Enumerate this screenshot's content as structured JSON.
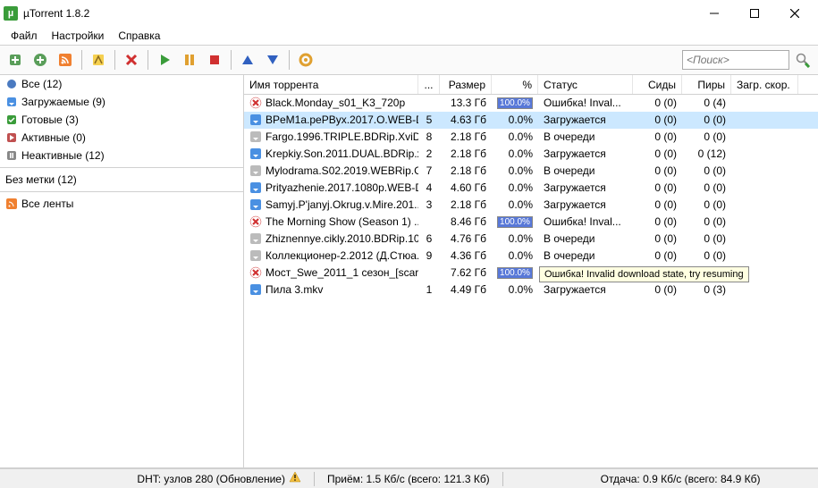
{
  "window": {
    "title": "µTorrent 1.8.2"
  },
  "menu": {
    "file": "Файл",
    "settings": "Настройки",
    "help": "Справка"
  },
  "search": {
    "placeholder": "<Поиск>"
  },
  "sidebar": {
    "all": "Все (12)",
    "downloading": "Загружаемые (9)",
    "completed": "Готовые (3)",
    "active": "Активные (0)",
    "inactive": "Неактивные (12)",
    "nolabel": "Без метки (12)",
    "feeds": "Все ленты"
  },
  "columns": {
    "name": "Имя торрента",
    "num": "...",
    "size": "Размер",
    "pct": "%",
    "status": "Статус",
    "seeds": "Сиды",
    "peers": "Пиры",
    "speed": "Загр. скор."
  },
  "torrents": [
    {
      "icon": "error",
      "name": "Black.Monday_s01_K3_720p",
      "num": "",
      "size": "13.3 Гб",
      "pct": "100.0%",
      "pctFull": true,
      "status": "Ошибка! Inval...",
      "seeds": "0 (0)",
      "peers": "0 (4)"
    },
    {
      "icon": "down",
      "name": "BPeM1a.pePByx.2017.O.WEB-D...",
      "num": "5",
      "size": "4.63 Гб",
      "pct": "0.0%",
      "pctFull": false,
      "status": "Загружается",
      "seeds": "0 (0)",
      "peers": "0 (0)",
      "selected": true
    },
    {
      "icon": "queued",
      "name": "Fargo.1996.TRIPLE.BDRip.XviD...",
      "num": "8",
      "size": "2.18 Гб",
      "pct": "0.0%",
      "pctFull": false,
      "status": "В очереди",
      "seeds": "0 (0)",
      "peers": "0 (0)"
    },
    {
      "icon": "down",
      "name": "Krepkiy.Son.2011.DUAL.BDRip.x...",
      "num": "2",
      "size": "2.18 Гб",
      "pct": "0.0%",
      "pctFull": false,
      "status": "Загружается",
      "seeds": "0 (0)",
      "peers": "0 (12)"
    },
    {
      "icon": "queued",
      "name": "Mylodrama.S02.2019.WEBRip.G...",
      "num": "7",
      "size": "2.18 Гб",
      "pct": "0.0%",
      "pctFull": false,
      "status": "В очереди",
      "seeds": "0 (0)",
      "peers": "0 (0)"
    },
    {
      "icon": "down",
      "name": "Prityazhenie.2017.1080p.WEB-D...",
      "num": "4",
      "size": "4.60 Гб",
      "pct": "0.0%",
      "pctFull": false,
      "status": "Загружается",
      "seeds": "0 (0)",
      "peers": "0 (0)"
    },
    {
      "icon": "down",
      "name": "Samyj.P'janyj.Okrug.v.Mire.201...",
      "num": "3",
      "size": "2.18 Гб",
      "pct": "0.0%",
      "pctFull": false,
      "status": "Загружается",
      "seeds": "0 (0)",
      "peers": "0 (0)"
    },
    {
      "icon": "error",
      "name": "The Morning Show (Season 1) ...",
      "num": "",
      "size": "8.46 Гб",
      "pct": "100.0%",
      "pctFull": true,
      "status": "Ошибка! Inval...",
      "seeds": "0 (0)",
      "peers": "0 (0)"
    },
    {
      "icon": "queued",
      "name": "Zhiznennye.cikly.2010.BDRip.10...",
      "num": "6",
      "size": "4.76 Гб",
      "pct": "0.0%",
      "pctFull": false,
      "status": "В очереди",
      "seeds": "0 (0)",
      "peers": "0 (0)"
    },
    {
      "icon": "queued",
      "name": "Коллекционер-2.2012 (Д.Стюа...",
      "num": "9",
      "size": "4.36 Гб",
      "pct": "0.0%",
      "pctFull": false,
      "status": "В очереди",
      "seeds": "0 (0)",
      "peers": "0 (0)"
    },
    {
      "icon": "error",
      "name": "Мост_Swe_2011_1 сезон_[scara...",
      "num": "",
      "size": "7.62 Гб",
      "pct": "100.0%",
      "pctFull": true,
      "status": "",
      "seeds": "",
      "peers": "",
      "tooltip": "Ошибка! Invalid download state, try resuming"
    },
    {
      "icon": "down",
      "name": "Пила 3.mkv",
      "num": "1",
      "size": "4.49 Гб",
      "pct": "0.0%",
      "pctFull": false,
      "status": "Загружается",
      "seeds": "0 (0)",
      "peers": "0 (3)"
    }
  ],
  "statusbar": {
    "dht": "DHT: узлов 280  (Обновление)",
    "down": "Приём: 1.5 Кб/с (всего: 121.3 Кб)",
    "up": "Отдача: 0.9 Кб/с (всего: 84.9 Кб)"
  }
}
